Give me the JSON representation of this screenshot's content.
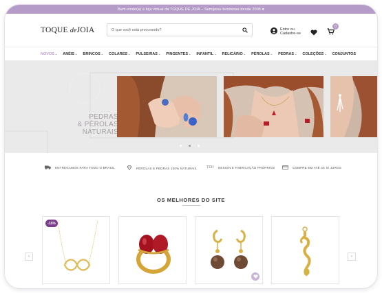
{
  "topbar": {
    "text": "Bem-vindo(a) à loja virtual da TOQUE DE JOIA – Semijoias femininas desde 2005 ♥"
  },
  "header": {
    "logo_main": "TOQUE",
    "logo_de": "de",
    "logo_end": "JOIA",
    "search_placeholder": "O que você está procurando?",
    "account_line1": "Entre ou",
    "account_line2": "Cadastre-se",
    "cart_count": "0"
  },
  "nav": {
    "items": [
      {
        "label": "NOVOS",
        "active": true
      },
      {
        "label": "ANÉIS"
      },
      {
        "label": "BRINCOS"
      },
      {
        "label": "COLARES"
      },
      {
        "label": "PULSEIRAS"
      },
      {
        "label": "PINGENTES"
      },
      {
        "label": "INFANTIL"
      },
      {
        "label": "RELICÁRIO"
      },
      {
        "label": "PÉROLAS"
      },
      {
        "label": "PEDRAS"
      },
      {
        "label": "COLEÇÕES"
      },
      {
        "label": "CONJUNTOS"
      }
    ]
  },
  "hero": {
    "line1": "PEDRAS",
    "line2": "& PÉROLAS",
    "line3": "NATURAIS",
    "dots": 3,
    "active_dot": 2
  },
  "features": {
    "shipping": "ENTREGAMOS PARA TODO O BRASIL",
    "pearls": "PÉROLAS E PEDRAS 100% NATURAIS",
    "design": "DESIGN E FABRICAÇÃO PRÓPRIOS",
    "installments": "COMPRE EM ATÉ 3X S/ JUROS",
    "design_mark": "TDJ"
  },
  "section": {
    "title": "OS MELHORES DO SITE"
  },
  "products": {
    "badge": "-15%"
  },
  "colors": {
    "accent": "#b49bc8",
    "badge": "#7a3d8a",
    "gold": "#d9b143",
    "hero_bg": "#ebeaeb"
  }
}
